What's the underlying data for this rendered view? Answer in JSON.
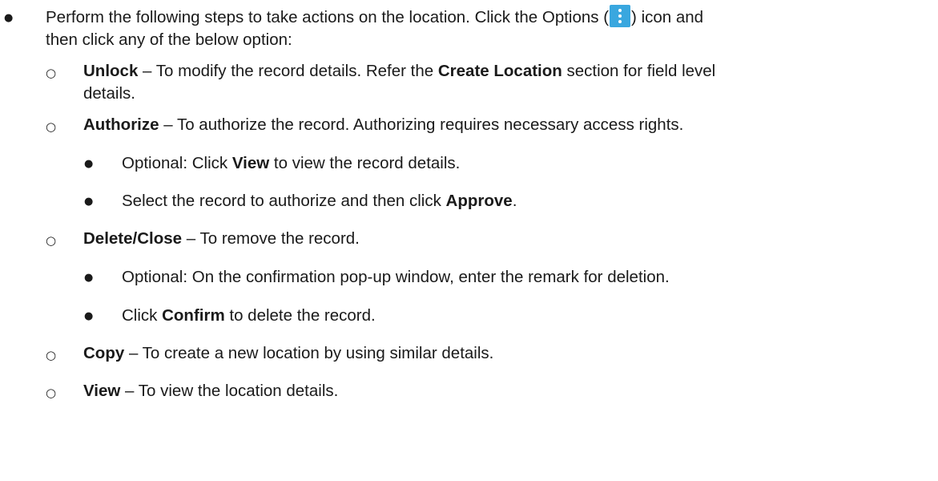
{
  "intro": {
    "line1_before_icon": "Perform the following steps to take actions on the location. Click the Options (",
    "icon": "options-kebab-icon",
    "line1_after_icon": ") icon and",
    "line2": "then click any of the below option:"
  },
  "unlock": {
    "term": "Unlock",
    "desc_a": " – To modify the record details. Refer the ",
    "ref": "Create Location",
    "desc_b": " section for field level",
    "desc_c": "details."
  },
  "authorize": {
    "term": "Authorize",
    "desc": " – To authorize the record. Authorizing requires necessary access rights.",
    "steps": [
      {
        "before": "Optional: Click ",
        "bold": "View",
        "after": " to view the record details."
      },
      {
        "before": "Select the record to authorize and then click ",
        "bold": "Approve",
        "after": "."
      }
    ]
  },
  "delete_close": {
    "term": "Delete/Close",
    "desc": " – To remove the record.",
    "steps": [
      {
        "text": "Optional: On the confirmation pop-up window, enter the remark for deletion."
      },
      {
        "before": "Click ",
        "bold": "Confirm",
        "after": " to delete the record."
      }
    ]
  },
  "copy": {
    "term": "Copy",
    "desc": " – To create a new location by using similar details."
  },
  "view": {
    "term": "View",
    "desc": " – To view the location details."
  },
  "colors": {
    "icon_bg": "#39a7df",
    "text": "#1a1a1a"
  }
}
